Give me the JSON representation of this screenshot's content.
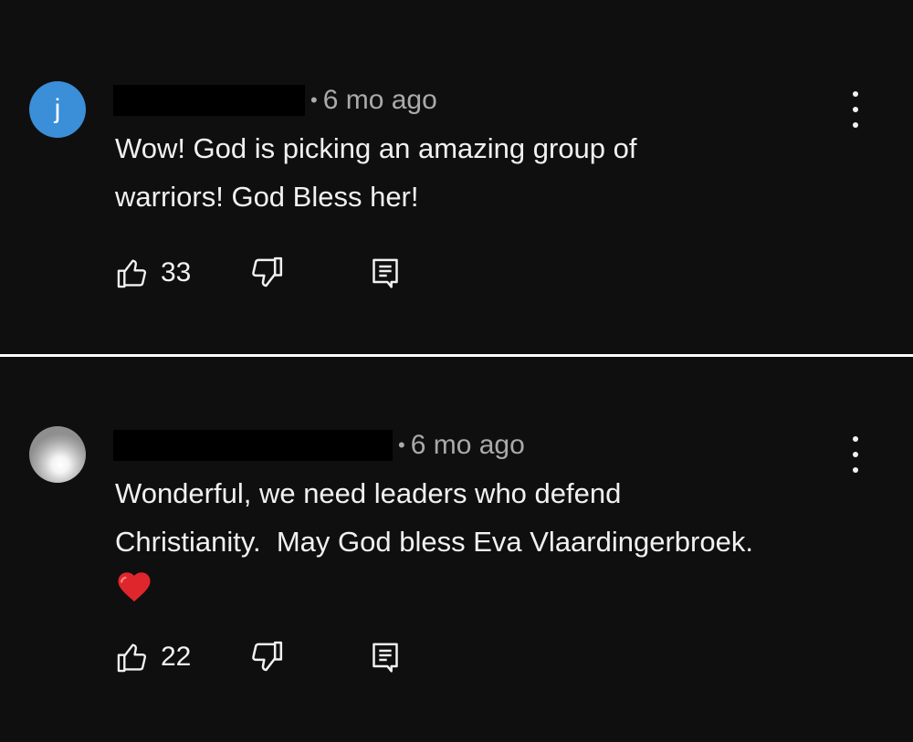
{
  "comments": [
    {
      "avatar_letter": "j",
      "avatar_color": "#3b8ed8",
      "age": "6 mo ago",
      "text_lines": [
        "Wow! God is picking an amazing group of",
        "warriors! God Bless her!"
      ],
      "likes": "33"
    },
    {
      "avatar_kind": "photo",
      "age": "6 mo ago",
      "text_lines": [
        "Wonderful, we need leaders who defend",
        "Christianity.  May God bless Eva Vlaardingerbroek."
      ],
      "emoji": "heart",
      "likes": "22"
    }
  ],
  "icons": {
    "like": "thumbs-up-icon",
    "dislike": "thumbs-down-icon",
    "reply": "reply-icon",
    "menu": "more-vertical-icon"
  },
  "colors": {
    "background": "#0f0f0f",
    "text": "#f1f1f1",
    "secondary_text": "#aaaaaa",
    "divider": "#ffffff"
  }
}
